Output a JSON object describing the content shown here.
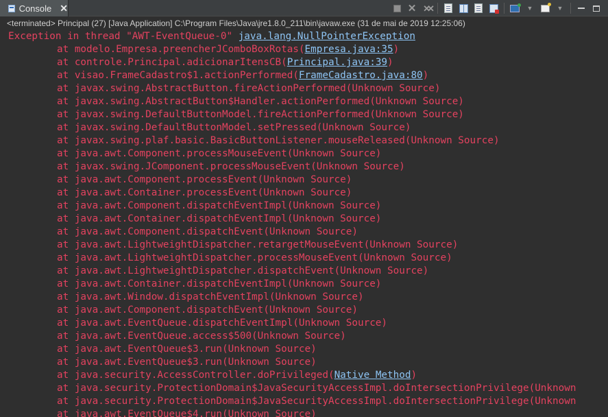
{
  "tab": {
    "icon": "console-icon",
    "label": "Console",
    "close": "✕"
  },
  "toolbar": {
    "buttons": [
      "terminate-icon",
      "remove-launch-icon",
      "remove-all-terminated-icon",
      "scroll-lock-icon",
      "show-on-stdout-icon",
      "show-on-stderr-icon",
      "word-wrap-icon",
      "display-selected-console-icon",
      "pin-console-icon",
      "open-console-icon",
      "minimize-icon",
      "maximize-icon"
    ]
  },
  "status": "<terminated> Principal (27) [Java Application] C:\\Program Files\\Java\\jre1.8.0_211\\bin\\javaw.exe (31 de mai de 2019 12:25:06)",
  "trace": {
    "header_text": "Exception in thread \"AWT-EventQueue-0\" ",
    "header_link": "java.lang.NullPointerException",
    "frames": [
      {
        "pre": "at modelo.Empresa.preencherJComboBoxRotas(",
        "link": "Empresa.java:35",
        "post": ")"
      },
      {
        "pre": "at controle.Principal.adicionarItensCB(",
        "link": "Principal.java:39",
        "post": ")"
      },
      {
        "pre": "at visao.FrameCadastro$1.actionPerformed(",
        "link": "FrameCadastro.java:80",
        "post": ")"
      },
      {
        "pre": "at javax.swing.AbstractButton.fireActionPerformed(Unknown Source)",
        "link": "",
        "post": ""
      },
      {
        "pre": "at javax.swing.AbstractButton$Handler.actionPerformed(Unknown Source)",
        "link": "",
        "post": ""
      },
      {
        "pre": "at javax.swing.DefaultButtonModel.fireActionPerformed(Unknown Source)",
        "link": "",
        "post": ""
      },
      {
        "pre": "at javax.swing.DefaultButtonModel.setPressed(Unknown Source)",
        "link": "",
        "post": ""
      },
      {
        "pre": "at javax.swing.plaf.basic.BasicButtonListener.mouseReleased(Unknown Source)",
        "link": "",
        "post": ""
      },
      {
        "pre": "at java.awt.Component.processMouseEvent(Unknown Source)",
        "link": "",
        "post": ""
      },
      {
        "pre": "at javax.swing.JComponent.processMouseEvent(Unknown Source)",
        "link": "",
        "post": ""
      },
      {
        "pre": "at java.awt.Component.processEvent(Unknown Source)",
        "link": "",
        "post": ""
      },
      {
        "pre": "at java.awt.Container.processEvent(Unknown Source)",
        "link": "",
        "post": ""
      },
      {
        "pre": "at java.awt.Component.dispatchEventImpl(Unknown Source)",
        "link": "",
        "post": ""
      },
      {
        "pre": "at java.awt.Container.dispatchEventImpl(Unknown Source)",
        "link": "",
        "post": ""
      },
      {
        "pre": "at java.awt.Component.dispatchEvent(Unknown Source)",
        "link": "",
        "post": ""
      },
      {
        "pre": "at java.awt.LightweightDispatcher.retargetMouseEvent(Unknown Source)",
        "link": "",
        "post": ""
      },
      {
        "pre": "at java.awt.LightweightDispatcher.processMouseEvent(Unknown Source)",
        "link": "",
        "post": ""
      },
      {
        "pre": "at java.awt.LightweightDispatcher.dispatchEvent(Unknown Source)",
        "link": "",
        "post": ""
      },
      {
        "pre": "at java.awt.Container.dispatchEventImpl(Unknown Source)",
        "link": "",
        "post": ""
      },
      {
        "pre": "at java.awt.Window.dispatchEventImpl(Unknown Source)",
        "link": "",
        "post": ""
      },
      {
        "pre": "at java.awt.Component.dispatchEvent(Unknown Source)",
        "link": "",
        "post": ""
      },
      {
        "pre": "at java.awt.EventQueue.dispatchEventImpl(Unknown Source)",
        "link": "",
        "post": ""
      },
      {
        "pre": "at java.awt.EventQueue.access$500(Unknown Source)",
        "link": "",
        "post": ""
      },
      {
        "pre": "at java.awt.EventQueue$3.run(Unknown Source)",
        "link": "",
        "post": ""
      },
      {
        "pre": "at java.awt.EventQueue$3.run(Unknown Source)",
        "link": "",
        "post": ""
      },
      {
        "pre": "at java.security.AccessController.doPrivileged(",
        "link": "Native Method",
        "post": ")"
      },
      {
        "pre": "at java.security.ProtectionDomain$JavaSecurityAccessImpl.doIntersectionPrivilege(Unknown",
        "link": "",
        "post": ""
      },
      {
        "pre": "at java.security.ProtectionDomain$JavaSecurityAccessImpl.doIntersectionPrivilege(Unknown",
        "link": "",
        "post": ""
      },
      {
        "pre": "at java.awt.EventQueue$4.run(Unknown Source)",
        "link": "",
        "post": ""
      }
    ]
  },
  "colors": {
    "error_text": "#e4425f",
    "link": "#8ec4f4",
    "background": "#2f2f2f"
  }
}
